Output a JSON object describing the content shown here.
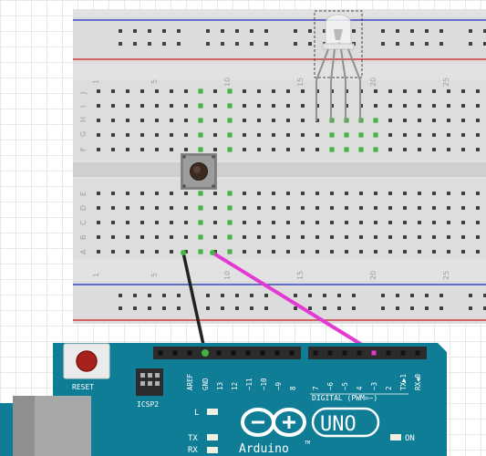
{
  "breadboard": {
    "row_letters_top": [
      "J",
      "I",
      "H",
      "G",
      "F"
    ],
    "row_letters_bottom": [
      "E",
      "D",
      "C",
      "B",
      "A"
    ],
    "column_numbers": [
      "1",
      "5",
      "10",
      "15",
      "20",
      "25"
    ]
  },
  "arduino": {
    "reset_label": "RESET",
    "icsp_label": "ICSP2",
    "aref_label": "AREF",
    "gnd_label": "GND",
    "pins_left": [
      "13",
      "12",
      "~11",
      "~10",
      "~9",
      "8"
    ],
    "pins_right": [
      "7",
      "~6",
      "~5",
      "4",
      "~3",
      "2",
      "TX▶1",
      "RX◀0"
    ],
    "digital_label": "DIGITAL (PWM=~)",
    "led_l": "L",
    "led_tx": "TX",
    "led_rx": "RX",
    "logo_text": "UNO",
    "brand": "Arduino",
    "trademark": "TM",
    "on_label": "ON"
  },
  "colors": {
    "arduino_blue": "#0f7d95",
    "header_black": "#2c2c2c",
    "wire_gnd": "#222222",
    "wire_signal": "#e23ad3",
    "reset_button": "#a8221d",
    "connected_hole": "#45b346"
  },
  "icons": {
    "arduino_logo": "infinity-plus-minus-logo",
    "pushbutton": "tactile-switch",
    "led": "rgb-led"
  }
}
